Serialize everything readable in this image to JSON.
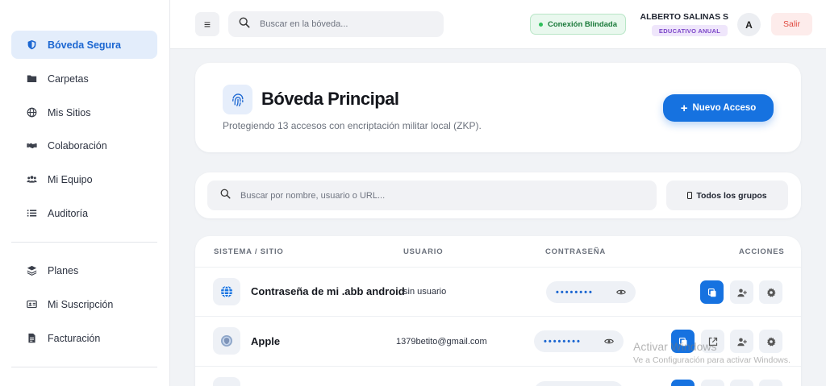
{
  "sidebar": {
    "items": [
      {
        "label": "Bóveda Segura",
        "icon": "shield-icon"
      },
      {
        "label": "Carpetas",
        "icon": "folder-icon"
      },
      {
        "label": "Mis Sitios",
        "icon": "globe-icon"
      },
      {
        "label": "Colaboración",
        "icon": "handshake-icon"
      },
      {
        "label": "Mi Equipo",
        "icon": "users-icon"
      },
      {
        "label": "Auditoría",
        "icon": "list-icon"
      }
    ],
    "items2": [
      {
        "label": "Planes",
        "icon": "layers-icon"
      },
      {
        "label": "Mi Suscripción",
        "icon": "id-card-icon"
      },
      {
        "label": "Facturación",
        "icon": "invoice-icon"
      }
    ]
  },
  "topbar": {
    "menu_icon": "≡",
    "search_placeholder": "Buscar en la bóveda...",
    "connection": "Conexión Blindada",
    "user_name": "ALBERTO SALINAS S",
    "plan": "EDUCATIVO ANUAL",
    "avatar": "A",
    "logout": "Salir"
  },
  "header": {
    "title": "Bóveda Principal",
    "subtitle": "Protegiendo 13 accesos con encriptación militar local (ZKP).",
    "new_button": "Nuevo Acceso",
    "new_button_icon": "+"
  },
  "filters": {
    "search_placeholder": "Buscar por nombre, usuario o URL...",
    "group_button": "Todos los grupos"
  },
  "table": {
    "headers": [
      "SISTEMA / SITIO",
      "USUARIO",
      "CONTRASEÑA",
      "ACCIONES"
    ],
    "rows": [
      {
        "name": "Contraseña de mi .abb android",
        "user": "sin usuario",
        "password": "••••••••",
        "icon": "globe-icon"
      },
      {
        "name": "Apple",
        "user": "1379betito@gmail.com",
        "password": "••••••••",
        "icon": "apple-avatar-icon"
      }
    ]
  },
  "watermark": {
    "line1": "Activar Windows",
    "line2": "Ve a Configuración para activar Windows."
  },
  "colors": {
    "accent": "#1672e0",
    "active_nav_bg": "#e3edfb",
    "success": "#1a7a3a",
    "danger": "#e0483e",
    "plan_purple": "#7b45c8"
  }
}
